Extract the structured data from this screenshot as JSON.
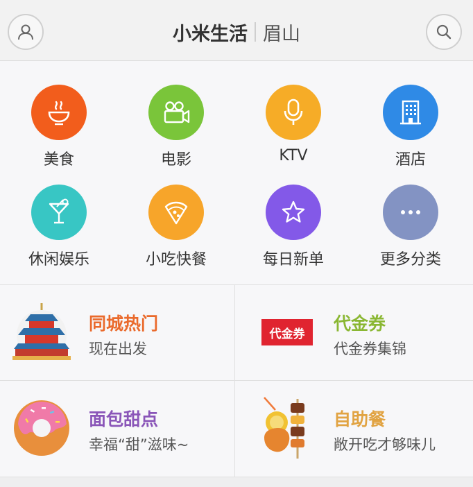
{
  "header": {
    "title": "小米生活",
    "city": "眉山",
    "profile_icon": "user-icon",
    "search_icon": "search-icon"
  },
  "categories": [
    {
      "label": "美食",
      "icon": "bowl-icon",
      "color": "#f25d1c"
    },
    {
      "label": "电影",
      "icon": "movie-camera-icon",
      "color": "#7ac53a"
    },
    {
      "label": "KTV",
      "icon": "microphone-icon",
      "color": "#f6ac27"
    },
    {
      "label": "酒店",
      "icon": "hotel-icon",
      "color": "#2f8ae6"
    },
    {
      "label": "休闲娱乐",
      "icon": "cocktail-icon",
      "color": "#38c6c4"
    },
    {
      "label": "小吃快餐",
      "icon": "pizza-icon",
      "color": "#f7a52a"
    },
    {
      "label": "每日新单",
      "icon": "star-icon",
      "color": "#8359e8"
    },
    {
      "label": "更多分类",
      "icon": "more-icon",
      "color": "#8393c3"
    }
  ],
  "cards": [
    {
      "title": "同城热门",
      "subtitle": "现在出发",
      "title_color": "#ea6a2c",
      "image": "temple-of-heaven-illustration"
    },
    {
      "title": "代金券",
      "subtitle": "代金券集锦",
      "title_color": "#8ab733",
      "image": "voucher-tag",
      "tag_text": "代金券",
      "tag_color": "#e02430"
    },
    {
      "title": "面包甜点",
      "subtitle": "幸福“甜”滋味~",
      "title_color": "#8a55b8",
      "image": "donut-illustration"
    },
    {
      "title": "自助餐",
      "subtitle": "敞开吃才够味儿",
      "title_color": "#e1a342",
      "image": "drink-and-skewer-illustration"
    }
  ]
}
